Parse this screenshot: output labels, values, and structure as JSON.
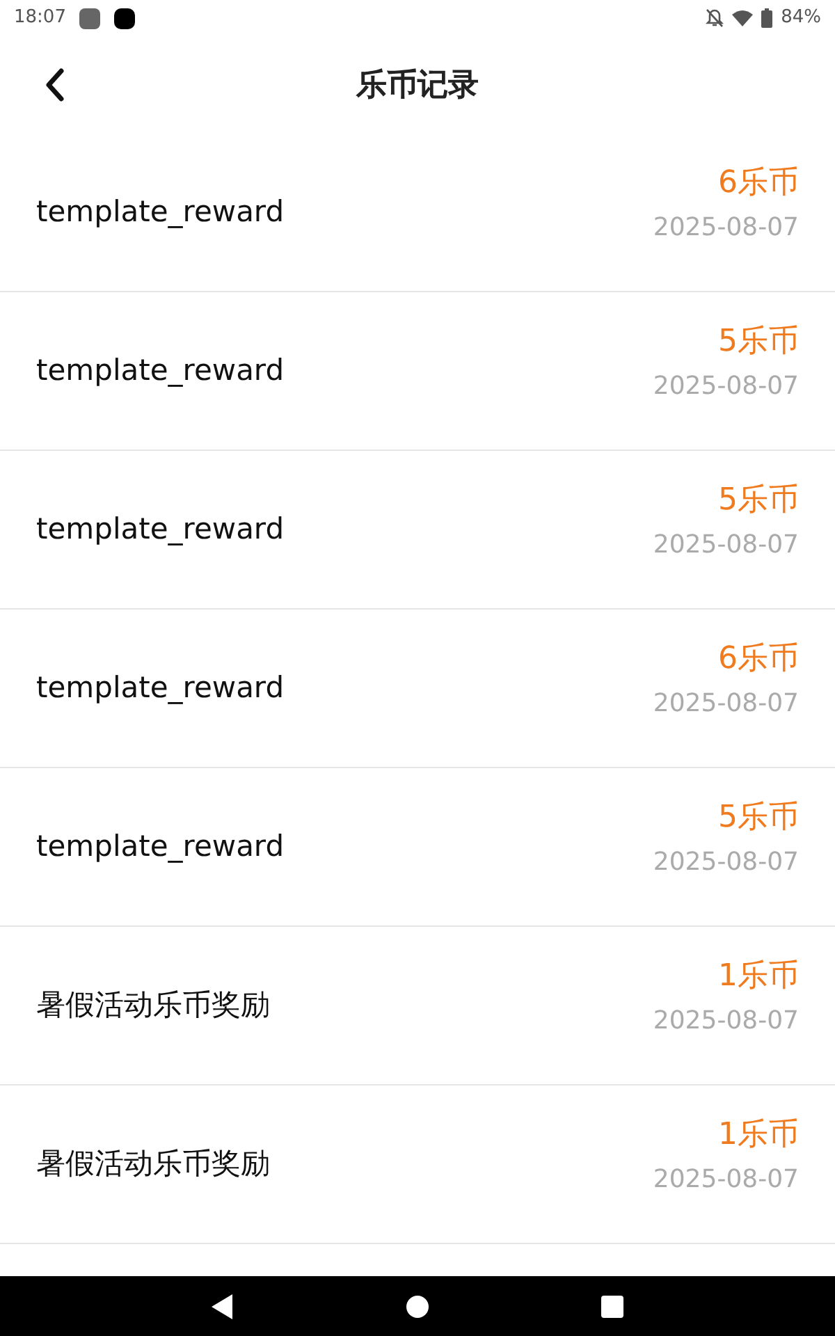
{
  "status_bar": {
    "time": "18:07",
    "battery": "84%"
  },
  "header": {
    "title": "乐币记录"
  },
  "records": [
    {
      "title": "template_reward",
      "amount": "6乐币",
      "date": "2025-08-07"
    },
    {
      "title": "template_reward",
      "amount": "5乐币",
      "date": "2025-08-07"
    },
    {
      "title": "template_reward",
      "amount": "5乐币",
      "date": "2025-08-07"
    },
    {
      "title": "template_reward",
      "amount": "6乐币",
      "date": "2025-08-07"
    },
    {
      "title": "template_reward",
      "amount": "5乐币",
      "date": "2025-08-07"
    },
    {
      "title": "暑假活动乐币奖励",
      "amount": "1乐币",
      "date": "2025-08-07"
    },
    {
      "title": "暑假活动乐币奖励",
      "amount": "1乐币",
      "date": "2025-08-07"
    }
  ]
}
